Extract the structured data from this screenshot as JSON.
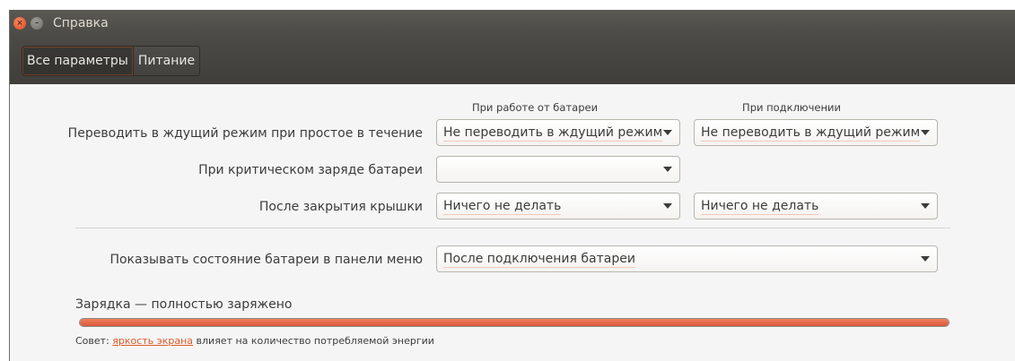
{
  "window": {
    "title": "Справка",
    "close_label": "×",
    "minimize_label": "–"
  },
  "tabs": [
    {
      "label": "Все параметры",
      "active": true
    },
    {
      "label": "Питание",
      "active": false
    }
  ],
  "columns": {
    "battery": "При работе от батареи",
    "plugged": "При подключении"
  },
  "rows": {
    "suspend_idle": {
      "label": "Переводить в ждущий режим при простое в течение",
      "battery_value": "Не переводить в ждущий режим",
      "plugged_value": "Не переводить в ждущий режим"
    },
    "critical": {
      "label": "При критическом заряде батареи",
      "battery_value": ""
    },
    "lid_close": {
      "label": "После закрытия крышки",
      "battery_value": "Ничего не делать",
      "plugged_value": "Ничего не делать"
    },
    "show_status": {
      "label": "Показывать состояние батареи в панели меню",
      "value": "После подключения батареи"
    }
  },
  "charge": {
    "status": "Зарядка — полностью заряжено",
    "level_percent": 100
  },
  "tip": {
    "prefix": "Совет: ",
    "link": "яркость экрана",
    "suffix": " влияет на количество потребляемой энергии"
  },
  "colors": {
    "accent": "#e05a2a",
    "titlebar": "#4b4a46",
    "progress_fill": "#e0603f"
  }
}
